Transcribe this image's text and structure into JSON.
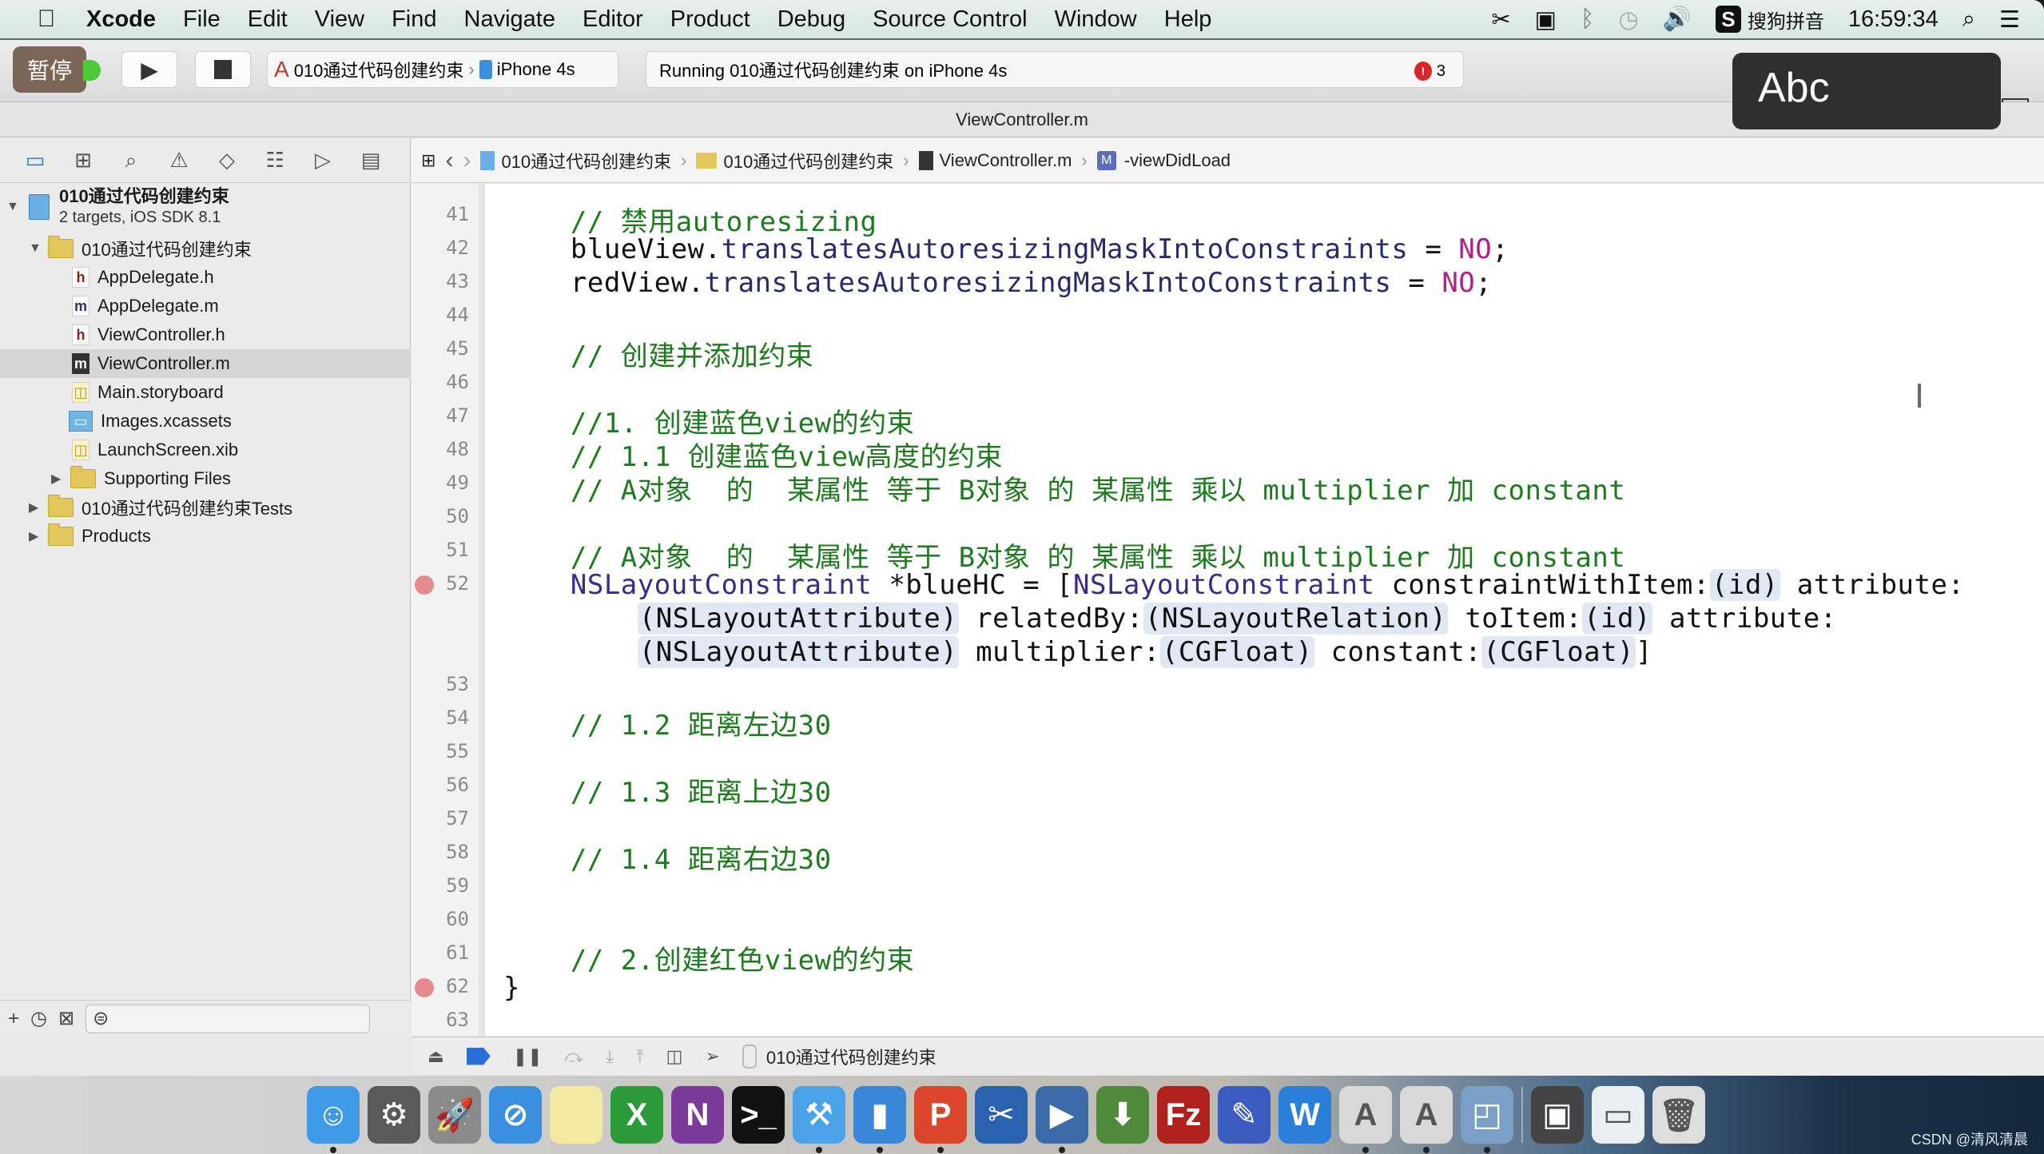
{
  "menubar": {
    "apple": "",
    "items": [
      "Xcode",
      "File",
      "Edit",
      "View",
      "Find",
      "Navigate",
      "Editor",
      "Product",
      "Debug",
      "Source Control",
      "Window",
      "Help"
    ],
    "input_method": "搜狗拼音",
    "input_method_badge": "S",
    "clock": "16:59:34"
  },
  "toolbar": {
    "pause_badge": "暂停",
    "scheme_name": "010通过代码创建约束",
    "device": "iPhone 4s",
    "activity": "Running 010通过代码创建约束 on iPhone 4s",
    "error_count": "3",
    "hud_text": "Abc"
  },
  "window": {
    "title": "ViewController.m"
  },
  "navigator": {
    "project": {
      "name": "010通过代码创建约束",
      "subtitle": "2 targets, iOS SDK 8.1"
    },
    "items": [
      {
        "label": "010通过代码创建约束",
        "type": "folder",
        "level": 1,
        "expanded": true
      },
      {
        "label": "AppDelegate.h",
        "type": "h",
        "level": 2
      },
      {
        "label": "AppDelegate.m",
        "type": "m",
        "level": 2
      },
      {
        "label": "ViewController.h",
        "type": "h",
        "level": 2
      },
      {
        "label": "ViewController.m",
        "type": "m",
        "level": 2,
        "selected": true
      },
      {
        "label": "Main.storyboard",
        "type": "storyboard",
        "level": 2
      },
      {
        "label": "Images.xcassets",
        "type": "xcassets",
        "level": 2
      },
      {
        "label": "LaunchScreen.xib",
        "type": "xib",
        "level": 2
      },
      {
        "label": "Supporting Files",
        "type": "folder",
        "level": 2,
        "expanded": false
      },
      {
        "label": "010通过代码创建约束Tests",
        "type": "folder",
        "level": 1,
        "expanded": false
      },
      {
        "label": "Products",
        "type": "folder",
        "level": 1,
        "expanded": false
      }
    ],
    "tabs": [
      "project-navigator",
      "symbol-navigator",
      "find-navigator",
      "issue-navigator",
      "test-navigator",
      "debug-navigator",
      "breakpoint-navigator",
      "report-navigator"
    ]
  },
  "jumpbar": {
    "crumbs": [
      "010通过代码创建约束",
      "010通过代码创建约束",
      "ViewController.m",
      "-viewDidLoad"
    ],
    "method_badge": "M"
  },
  "editor": {
    "lines": [
      {
        "n": "41",
        "text": "    // 禁用autoresizing",
        "kind": "comment"
      },
      {
        "n": "42",
        "text": "    blueView.translatesAutoresizingMaskIntoConstraints = NO;",
        "kind": "code"
      },
      {
        "n": "43",
        "text": "    redView.translatesAutoresizingMaskIntoConstraints = NO;",
        "kind": "code"
      },
      {
        "n": "44",
        "text": "",
        "kind": "blank"
      },
      {
        "n": "45",
        "text": "    // 创建并添加约束",
        "kind": "comment"
      },
      {
        "n": "46",
        "text": "",
        "kind": "blank"
      },
      {
        "n": "47",
        "text": "    //1. 创建蓝色view的约束",
        "kind": "comment"
      },
      {
        "n": "48",
        "text": "    // 1.1 创建蓝色view高度的约束",
        "kind": "comment"
      },
      {
        "n": "49",
        "text": "    // A对象  的  某属性 等于 B对象 的 某属性 乘以 multiplier 加 constant",
        "kind": "comment"
      },
      {
        "n": "50",
        "text": "",
        "kind": "blank"
      },
      {
        "n": "51",
        "text": "    // A对象  的  某属性 等于 B对象 的 某属性 乘以 multiplier 加 constant",
        "kind": "comment"
      },
      {
        "n": "52",
        "text": "    NSLayoutConstraint *blueHC = [NSLayoutConstraint constraintWithItem:(id) attribute:",
        "kind": "code",
        "error": true
      },
      {
        "n": "",
        "text": "        (NSLayoutAttribute) relatedBy:(NSLayoutRelation) toItem:(id) attribute:",
        "kind": "code"
      },
      {
        "n": "",
        "text": "        (NSLayoutAttribute) multiplier:(CGFloat) constant:(CGFloat)]",
        "kind": "code"
      },
      {
        "n": "53",
        "text": "",
        "kind": "blank"
      },
      {
        "n": "54",
        "text": "    // 1.2 距离左边30",
        "kind": "comment"
      },
      {
        "n": "55",
        "text": "",
        "kind": "blank"
      },
      {
        "n": "56",
        "text": "    // 1.3 距离上边30",
        "kind": "comment"
      },
      {
        "n": "57",
        "text": "",
        "kind": "blank"
      },
      {
        "n": "58",
        "text": "    // 1.4 距离右边30",
        "kind": "comment"
      },
      {
        "n": "59",
        "text": "",
        "kind": "blank"
      },
      {
        "n": "60",
        "text": "",
        "kind": "blank"
      },
      {
        "n": "61",
        "text": "    // 2.创建红色view的约束",
        "kind": "comment"
      },
      {
        "n": "62",
        "text": "}",
        "kind": "code",
        "error": true
      },
      {
        "n": "63",
        "text": "",
        "kind": "blank"
      }
    ]
  },
  "debugbar": {
    "process": "010通过代码创建约束"
  },
  "dock": {
    "apps": [
      "Finder",
      "System Preferences",
      "Launchpad",
      "Safari",
      "Notes",
      "Excel",
      "OneNote",
      "Terminal",
      "Xcode",
      "Simulator",
      "PowerPoint",
      "Snip",
      "Video",
      "Transmit",
      "FileZilla",
      "Pencil",
      "Word",
      "Instruments",
      "Instruments",
      "Preview",
      "Screen",
      "Screenshot",
      "Trash"
    ],
    "colors": [
      "#3f9ae8",
      "#5a5a5a",
      "#8a8a8a",
      "#3a8fe0",
      "#f4e9a0",
      "#2d9a3a",
      "#7a3a9a",
      "#111111",
      "#4aa3e8",
      "#3a86d8",
      "#d9462b",
      "#2a62b0",
      "#3c6aa8",
      "#4e8a3a",
      "#b0201c",
      "#3a5cc0",
      "#2a7fd8",
      "#d8d8d8",
      "#d8d8d8",
      "#7aa0c8",
      "#444444",
      "#e8eef2",
      "#dedede"
    ],
    "glyphs": [
      "☺",
      "⚙",
      "🚀",
      "⊘",
      "",
      "X",
      "N",
      ">_",
      "⚒",
      "▮",
      "P",
      "✂",
      "▶",
      "⬇",
      "Fz",
      "✎",
      "W",
      "A",
      "A",
      "◰",
      "▣",
      "▭",
      "🗑"
    ],
    "running": [
      true,
      false,
      false,
      false,
      false,
      false,
      false,
      false,
      true,
      true,
      true,
      false,
      true,
      false,
      false,
      false,
      false,
      true,
      true,
      true,
      false,
      false,
      false
    ]
  },
  "watermark": "CSDN @清风清晨"
}
